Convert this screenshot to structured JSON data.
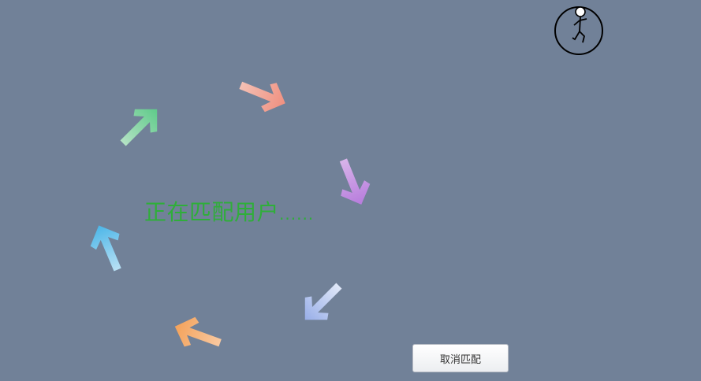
{
  "matching": {
    "status_text": "正在匹配用户",
    "status_dots": "......"
  },
  "cancel_button": {
    "label": "取消匹配"
  },
  "spinner_arrows": [
    {
      "name": "arrow-up-right-icon",
      "color_from": "#b4e2c4",
      "color_to": "#5fca8a"
    },
    {
      "name": "arrow-right-icon",
      "color_from": "#f4c0b4",
      "color_to": "#f09080"
    },
    {
      "name": "arrow-down-icon",
      "color_from": "#d8b4ea",
      "color_to": "#b77cdc"
    },
    {
      "name": "arrow-down-left-icon",
      "color_from": "#e0e8f8",
      "color_to": "#98aee8"
    },
    {
      "name": "arrow-left-icon",
      "color_from": "#f8c8a0",
      "color_to": "#f4a25a"
    },
    {
      "name": "arrow-up-icon",
      "color_from": "#b8e0f4",
      "color_to": "#4cb6e8"
    }
  ],
  "colors": {
    "background": "#718198",
    "status_text": "#2fae3a"
  }
}
